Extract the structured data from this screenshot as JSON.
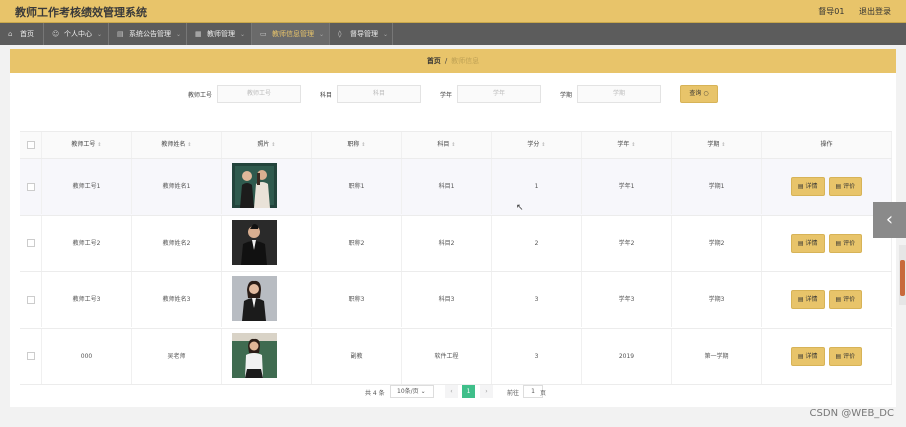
{
  "header": {
    "title": "教师工作考核绩效管理系统",
    "user": "督导01",
    "logout": "退出登录"
  },
  "nav": [
    {
      "label": "首页",
      "icon": "home-icon",
      "glyph": "⌂"
    },
    {
      "label": "个人中心",
      "icon": "user-icon",
      "glyph": "☺"
    },
    {
      "label": "系统公告管理",
      "icon": "notice-icon",
      "glyph": "▤"
    },
    {
      "label": "教师管理",
      "icon": "teacher-icon",
      "glyph": "▦"
    },
    {
      "label": "教师信息管理",
      "icon": "info-icon",
      "glyph": "▭"
    },
    {
      "label": "督导管理",
      "icon": "supervisor-icon",
      "glyph": "◊"
    }
  ],
  "breadcrumb": {
    "home": "首页",
    "sep": "/",
    "current": "教师信息"
  },
  "search": {
    "fields": [
      {
        "label": "教师工号",
        "placeholder": "教师工号"
      },
      {
        "label": "科目",
        "placeholder": "科目"
      },
      {
        "label": "学年",
        "placeholder": "学年"
      },
      {
        "label": "学期",
        "placeholder": "学期"
      }
    ],
    "button": "查询"
  },
  "table": {
    "columns": [
      "教师工号",
      "教师姓名",
      "照片",
      "职称",
      "科目",
      "学分",
      "学年",
      "学期",
      "操作"
    ],
    "rows": [
      {
        "id": "教师工号1",
        "name": "教师姓名1",
        "title": "职称1",
        "subject": "科目1",
        "credit": "1",
        "year": "学年1",
        "term": "学期1"
      },
      {
        "id": "教师工号2",
        "name": "教师姓名2",
        "title": "职称2",
        "subject": "科目2",
        "credit": "2",
        "year": "学年2",
        "term": "学期2"
      },
      {
        "id": "教师工号3",
        "name": "教师姓名3",
        "title": "职称3",
        "subject": "科目3",
        "credit": "3",
        "year": "学年3",
        "term": "学期3"
      },
      {
        "id": "000",
        "name": "吴老师",
        "title": "副教",
        "subject": "软件工程",
        "credit": "3",
        "year": "2019",
        "term": "第一学期"
      }
    ],
    "actions": {
      "detail": "详情",
      "evaluate": "评价"
    }
  },
  "pagination": {
    "total": "共 4 条",
    "page_size": "10条/页",
    "current": "1",
    "goto_label": "前往",
    "goto_value": "1",
    "page_suffix": "页"
  },
  "watermark": "CSDN @WEB_DC",
  "colors": {
    "accent": "#e8c46a",
    "nav_bg": "#5c5c5c",
    "page_active": "#3fbf8a"
  }
}
